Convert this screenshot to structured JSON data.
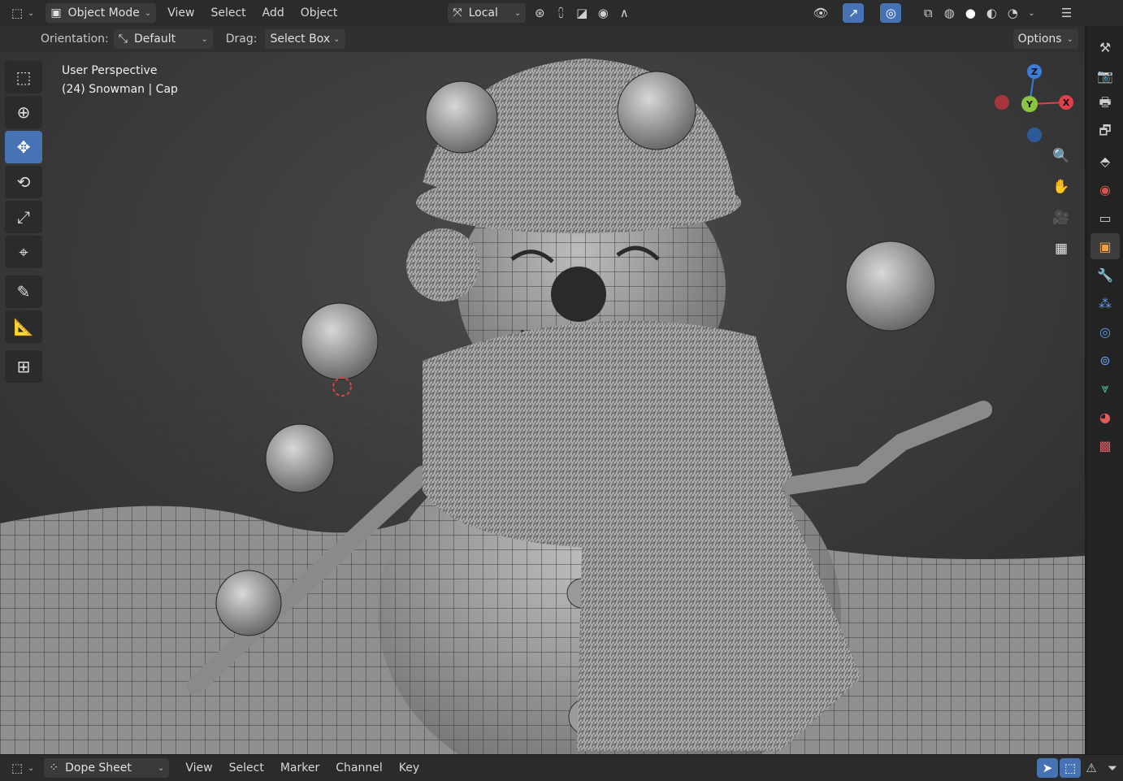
{
  "header": {
    "mode_label": "Object Mode",
    "menus": [
      "View",
      "Select",
      "Add",
      "Object"
    ],
    "transform_space": "Local"
  },
  "tool_header": {
    "orientation_label": "Orientation:",
    "orientation_value": "Default",
    "drag_label": "Drag:",
    "drag_value": "Select Box",
    "options_label": "Options"
  },
  "viewport": {
    "perspective_label": "User Perspective",
    "object_label": "(24) Snowman | Cap"
  },
  "gizmo": {
    "x": "X",
    "y": "Y",
    "z": "Z"
  },
  "toolbar": {
    "tools": [
      "select-box",
      "cursor",
      "move",
      "rotate",
      "scale",
      "transform",
      "annotate",
      "measure",
      "add-cube"
    ],
    "active_tool": "move"
  },
  "bottom": {
    "editor_label": "Dope Sheet",
    "menus": [
      "View",
      "Select",
      "Marker",
      "Channel",
      "Key"
    ]
  },
  "colors": {
    "accent": "#4772b3",
    "axis_x": "#e0404d",
    "axis_y": "#8bc53f",
    "axis_z": "#3b7cd6"
  }
}
